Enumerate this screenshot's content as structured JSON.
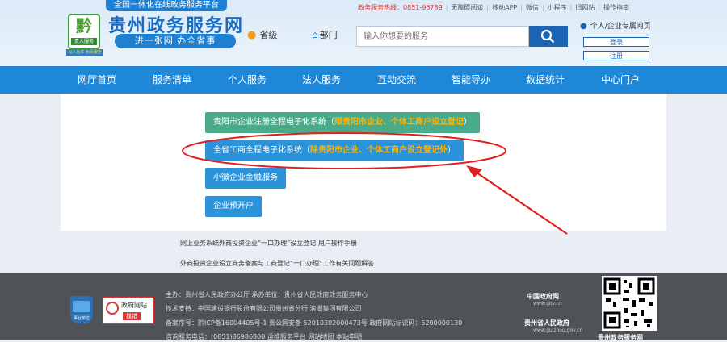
{
  "header": {
    "platform_banner": "全国一体化在线政务服务平台",
    "site_title": "贵州政务服务网",
    "slogan": "进一张网 办全省事",
    "logo_tag": "贵人服务",
    "logo_slogan": "以人为本 为民服务",
    "province_label": "省级",
    "dept_label": "部门",
    "search_placeholder": "输入你想要的服务",
    "hotline": "政务服务热线：0851-96789",
    "top_links": [
      "无障碍阅读",
      "移动APP",
      "微信",
      "小程序",
      "旧网站",
      "操作指南"
    ],
    "user_link": "个人/企业专属网页",
    "login": "登录",
    "register": "注册"
  },
  "nav": {
    "items": [
      "网厅首页",
      "服务清单",
      "个人服务",
      "法人服务",
      "互动交流",
      "智能导办",
      "数据统计",
      "中心门户"
    ]
  },
  "main": {
    "services": [
      {
        "label": "贵阳市企业注册全程电子化系统（",
        "note": "限贵阳市企业、个体工商户设立登记",
        "end": "）"
      },
      {
        "label": "全省工商全程电子化系统（",
        "note": "除贵阳市企业、个体工商户设立登记外",
        "end": "）"
      },
      {
        "label": "小微企业金融服务",
        "note": "",
        "end": ""
      },
      {
        "label": "企业预开户",
        "note": "",
        "end": ""
      }
    ],
    "links": [
      "网上业务系统外商投资企业“一口办理”设立登记 用户操作手册",
      "外商投资企业设立商务备案与工商登记“一口办理”工作有关问题解答"
    ]
  },
  "footer": {
    "lines": [
      "主办：贵州省人民政府办公厅  承办单位：贵州省人民政府政务服务中心",
      "技术支持：中国建设银行股份有限公司贵州省分行  浪潮集团有限公司",
      "备案序号：黔ICP备16004405号-1  贵公网安备 52010302000473号  政府网站标识码：5200000130",
      "咨询服务电话：(0851)86986800  运维服务平台  网站地图  本站申明"
    ],
    "badge_text": "事业单位",
    "gov_site_a": "政府网站",
    "gov_site_b": "找错",
    "china_gov": "中国政府网",
    "china_gov_url": "www.gov.cn",
    "gz_gov": "贵州省人民政府",
    "gz_gov_url": "www.guizhou.gov.cn",
    "qr_label": "贵州政务服务网"
  },
  "colors": {
    "nav_blue": "#1e87d8",
    "green_button": "#4aab8c",
    "blue_button": "#2a93da",
    "highlight": "#ffb400",
    "annotation_red": "#e02020"
  }
}
